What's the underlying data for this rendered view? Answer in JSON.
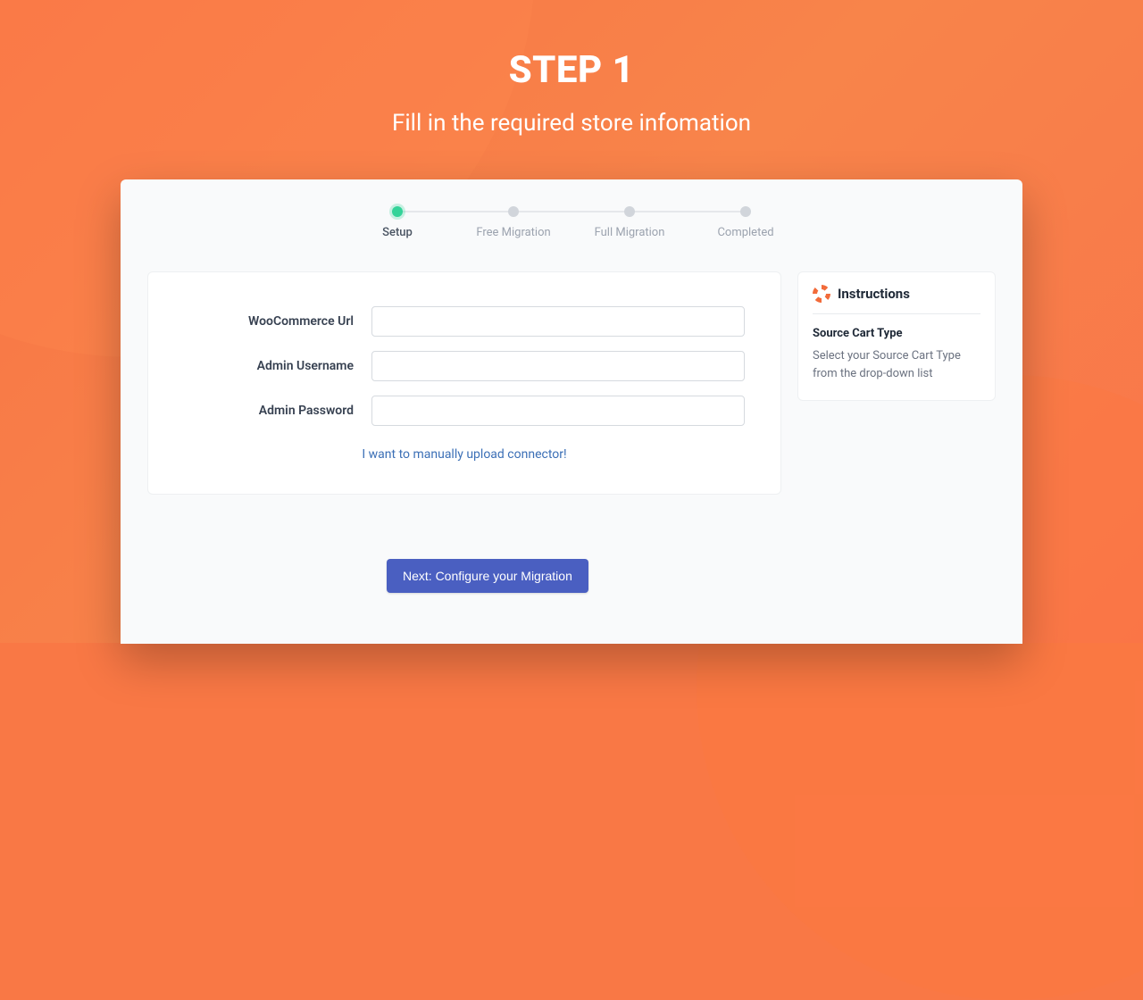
{
  "hero": {
    "title": "STEP 1",
    "subtitle": "Fill in the required store infomation"
  },
  "stepper": {
    "steps": [
      {
        "label": "Setup",
        "active": true
      },
      {
        "label": "Free Migration",
        "active": false
      },
      {
        "label": "Full Migration",
        "active": false
      },
      {
        "label": "Completed",
        "active": false
      }
    ]
  },
  "form": {
    "fields": {
      "url": {
        "label": "WooCommerce Url",
        "value": ""
      },
      "username": {
        "label": "Admin Username",
        "value": ""
      },
      "password": {
        "label": "Admin Password",
        "value": ""
      }
    },
    "manual_link": "I want to manually upload connector!"
  },
  "instructions": {
    "title": "Instructions",
    "heading": "Source Cart Type",
    "body": "Select your Source Cart Type from the drop-down list"
  },
  "actions": {
    "next_label": "Next: Configure your Migration"
  }
}
